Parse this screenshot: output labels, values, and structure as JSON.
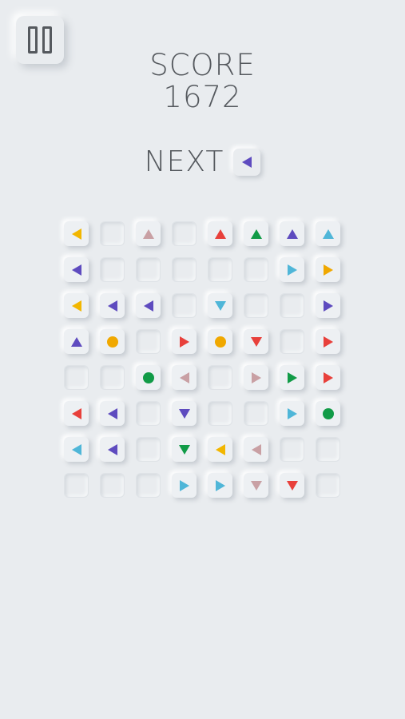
{
  "header": {
    "score_label": "SCORE",
    "score_value": "1672",
    "next_label": "NEXT"
  },
  "controls": {
    "pause_icon": "pause-icon"
  },
  "next_piece": {
    "shape": "left",
    "color": "#5e4bbf"
  },
  "colors": {
    "yellow": "#f2b600",
    "purple": "#5e4bbf",
    "pink": "#c9a0a4",
    "red": "#e8403b",
    "green": "#119b47",
    "cyan": "#4fb6d8",
    "orange": "#f0a800"
  },
  "board": {
    "rows": 8,
    "cols": 8,
    "cells": [
      [
        {
          "s": "left",
          "c": "#f2b600"
        },
        {
          "s": "empty"
        },
        {
          "s": "up",
          "c": "#c9a0a4"
        },
        {
          "s": "empty"
        },
        {
          "s": "up",
          "c": "#e8403b"
        },
        {
          "s": "up",
          "c": "#119b47"
        },
        {
          "s": "up",
          "c": "#5e4bbf"
        },
        {
          "s": "up",
          "c": "#4fb6d8"
        }
      ],
      [
        {
          "s": "left",
          "c": "#5e4bbf"
        },
        {
          "s": "empty"
        },
        {
          "s": "empty"
        },
        {
          "s": "empty"
        },
        {
          "s": "empty"
        },
        {
          "s": "empty"
        },
        {
          "s": "right",
          "c": "#4fb6d8"
        },
        {
          "s": "right",
          "c": "#f0a800"
        }
      ],
      [
        {
          "s": "left",
          "c": "#f2b600"
        },
        {
          "s": "left",
          "c": "#5e4bbf"
        },
        {
          "s": "left",
          "c": "#5e4bbf"
        },
        {
          "s": "empty"
        },
        {
          "s": "down",
          "c": "#4fb6d8"
        },
        {
          "s": "empty"
        },
        {
          "s": "empty"
        },
        {
          "s": "right",
          "c": "#5e4bbf"
        }
      ],
      [
        {
          "s": "up",
          "c": "#5e4bbf"
        },
        {
          "s": "circle",
          "c": "#f0a800"
        },
        {
          "s": "empty"
        },
        {
          "s": "right",
          "c": "#e8403b"
        },
        {
          "s": "circle",
          "c": "#f0a800"
        },
        {
          "s": "down",
          "c": "#e8403b"
        },
        {
          "s": "empty"
        },
        {
          "s": "right",
          "c": "#e8403b"
        }
      ],
      [
        {
          "s": "empty"
        },
        {
          "s": "empty"
        },
        {
          "s": "circle",
          "c": "#119b47"
        },
        {
          "s": "left",
          "c": "#c9a0a4"
        },
        {
          "s": "empty"
        },
        {
          "s": "right",
          "c": "#c9a0a4"
        },
        {
          "s": "right",
          "c": "#119b47"
        },
        {
          "s": "right",
          "c": "#e8403b"
        }
      ],
      [
        {
          "s": "left",
          "c": "#e8403b"
        },
        {
          "s": "left",
          "c": "#5e4bbf"
        },
        {
          "s": "empty"
        },
        {
          "s": "down",
          "c": "#5e4bbf"
        },
        {
          "s": "empty"
        },
        {
          "s": "empty"
        },
        {
          "s": "right",
          "c": "#4fb6d8"
        },
        {
          "s": "circle",
          "c": "#119b47"
        }
      ],
      [
        {
          "s": "left",
          "c": "#4fb6d8"
        },
        {
          "s": "left",
          "c": "#5e4bbf"
        },
        {
          "s": "empty"
        },
        {
          "s": "down",
          "c": "#119b47"
        },
        {
          "s": "left",
          "c": "#f2b600"
        },
        {
          "s": "left",
          "c": "#c9a0a4"
        },
        {
          "s": "empty"
        },
        {
          "s": "empty"
        }
      ],
      [
        {
          "s": "empty"
        },
        {
          "s": "empty"
        },
        {
          "s": "empty"
        },
        {
          "s": "right",
          "c": "#4fb6d8"
        },
        {
          "s": "right",
          "c": "#4fb6d8"
        },
        {
          "s": "down",
          "c": "#c9a0a4"
        },
        {
          "s": "down",
          "c": "#e8403b"
        },
        {
          "s": "empty"
        }
      ]
    ]
  }
}
